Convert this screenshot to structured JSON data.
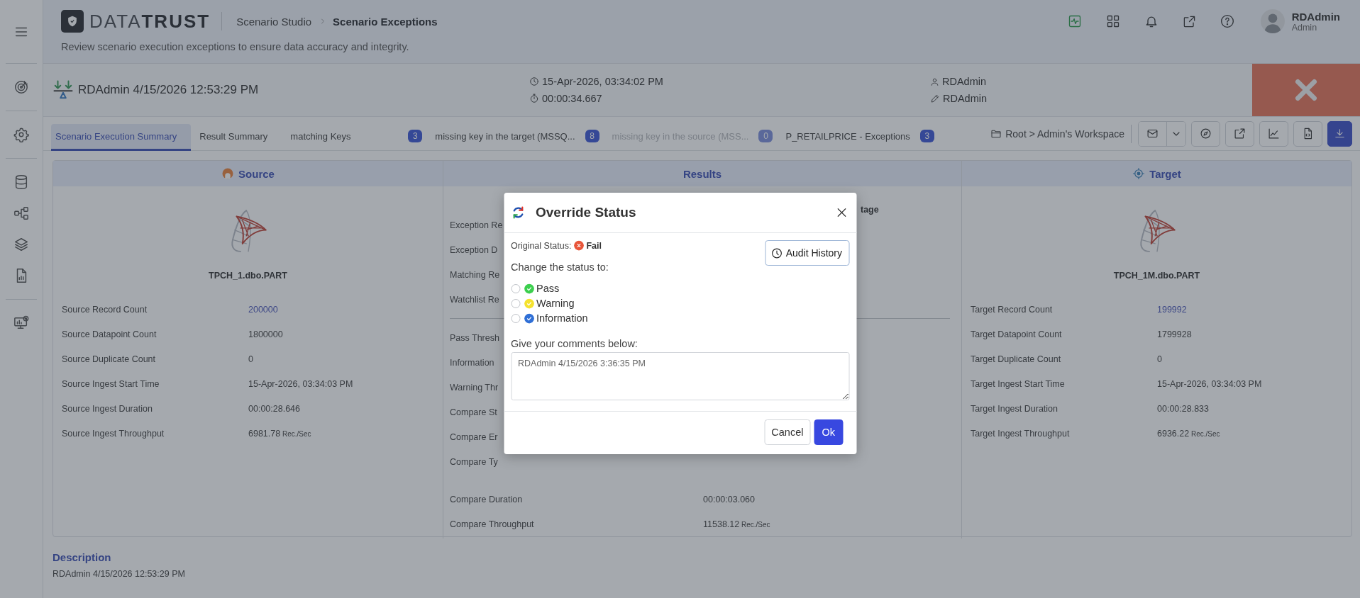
{
  "header": {
    "logo": "DATA**TRUST**",
    "breadcrumb": [
      {
        "label": "Scenario Studio",
        "current": false
      },
      {
        "label": "Scenario Exceptions",
        "current": true
      }
    ],
    "subtitle": "Review scenario execution exceptions to ensure data accuracy and integrity.",
    "user": {
      "name": "RDAdmin",
      "role": "Admin"
    }
  },
  "run": {
    "title": "RDAdmin 4/15/2026 12:53:29 PM",
    "started": "15-Apr-2026, 03:34:02 PM",
    "duration": "00:00:34.667",
    "owner": "RDAdmin",
    "modified_by": "RDAdmin",
    "failed": true
  },
  "tabs": [
    {
      "label": "Scenario Execution Summary",
      "selected": true,
      "disabled": false
    },
    {
      "label": "Result Summary",
      "selected": false,
      "disabled": false
    },
    {
      "label": "matching Keys",
      "badge": "3",
      "selected": false,
      "disabled": false
    },
    {
      "label": "missing key in the target (MSSQ...",
      "badge": "8",
      "selected": false,
      "disabled": false
    },
    {
      "label": "missing key in the source (MSS...",
      "badge": "0",
      "selected": false,
      "disabled": true
    },
    {
      "label": "P_RETAILPRICE - Exceptions",
      "badge": "3",
      "selected": false,
      "disabled": false
    }
  ],
  "workspace_path": "Root > Admin's Workspace",
  "source": {
    "title": "Source",
    "table_name": "TPCH_1.dbo.PART",
    "rows": [
      {
        "label": "Source Record Count",
        "value": "200000",
        "link": true
      },
      {
        "label": "Source Datapoint Count",
        "value": "1800000",
        "link": false
      },
      {
        "label": "Source Duplicate Count",
        "value": "0",
        "link": false
      },
      {
        "label": "Source Ingest Start Time",
        "value": "15-Apr-2026, 03:34:03 PM",
        "link": false
      },
      {
        "label": "Source Ingest Duration",
        "value": "00:00:28.646",
        "link": false
      },
      {
        "label": "Source Ingest Throughput",
        "value": "6981.78",
        "unit": "Rec./Sec",
        "link": false
      }
    ]
  },
  "results": {
    "title": "Results",
    "column_header": "tage",
    "groups": [
      {
        "divider": true,
        "rows": [
          {
            "label": "Exception Re"
          },
          {
            "label": "Exception D"
          },
          {
            "label": "Matching Re"
          },
          {
            "label": "Watchlist Re"
          }
        ]
      },
      {
        "divider": false,
        "rows": [
          {
            "label": "Pass Thresh"
          },
          {
            "label": "Information"
          },
          {
            "label": "Warning Thr"
          },
          {
            "label": "Compare St"
          },
          {
            "label": "Compare Er"
          },
          {
            "label": "Compare Ty"
          }
        ]
      },
      {
        "divider": false,
        "rows": [
          {
            "label": "Compare Duration",
            "value": "00:00:03.060"
          },
          {
            "label": "Compare Throughput",
            "value": "11538.12",
            "unit": "Rec./Sec"
          }
        ]
      }
    ]
  },
  "target": {
    "title": "Target",
    "table_name": "TPCH_1M.dbo.PART",
    "rows": [
      {
        "label": "Target Record Count",
        "value": "199992",
        "link": true
      },
      {
        "label": "Target Datapoint Count",
        "value": "1799928",
        "link": false
      },
      {
        "label": "Target Duplicate Count",
        "value": "0",
        "link": false
      },
      {
        "label": "Target Ingest Start Time",
        "value": "15-Apr-2026, 03:34:03 PM",
        "link": false
      },
      {
        "label": "Target Ingest Duration",
        "value": "00:00:28.833",
        "link": false
      },
      {
        "label": "Target Ingest Throughput",
        "value": "6936.22",
        "unit": "Rec./Sec",
        "link": false
      }
    ]
  },
  "description": {
    "title": "Description",
    "text": "RDAdmin 4/15/2026 12:53:29 PM"
  },
  "dialog": {
    "title": "Override Status",
    "original_status_label": "Original Status:",
    "original_status": {
      "kind": "fail",
      "label": "Fail"
    },
    "audit_button": "Audit History",
    "change_label": "Change the status to:",
    "options": [
      {
        "kind": "pass",
        "label": "Pass",
        "selected": false
      },
      {
        "kind": "warning",
        "label": "Warning",
        "selected": false
      },
      {
        "kind": "information",
        "label": "Information",
        "selected": false
      }
    ],
    "comments_label": "Give your comments below:",
    "comments": "RDAdmin 4/15/2026 3:36:35 PM",
    "buttons": [
      {
        "kind": "secondary",
        "label": "Cancel"
      },
      {
        "kind": "primary",
        "label": "Ok"
      }
    ]
  }
}
